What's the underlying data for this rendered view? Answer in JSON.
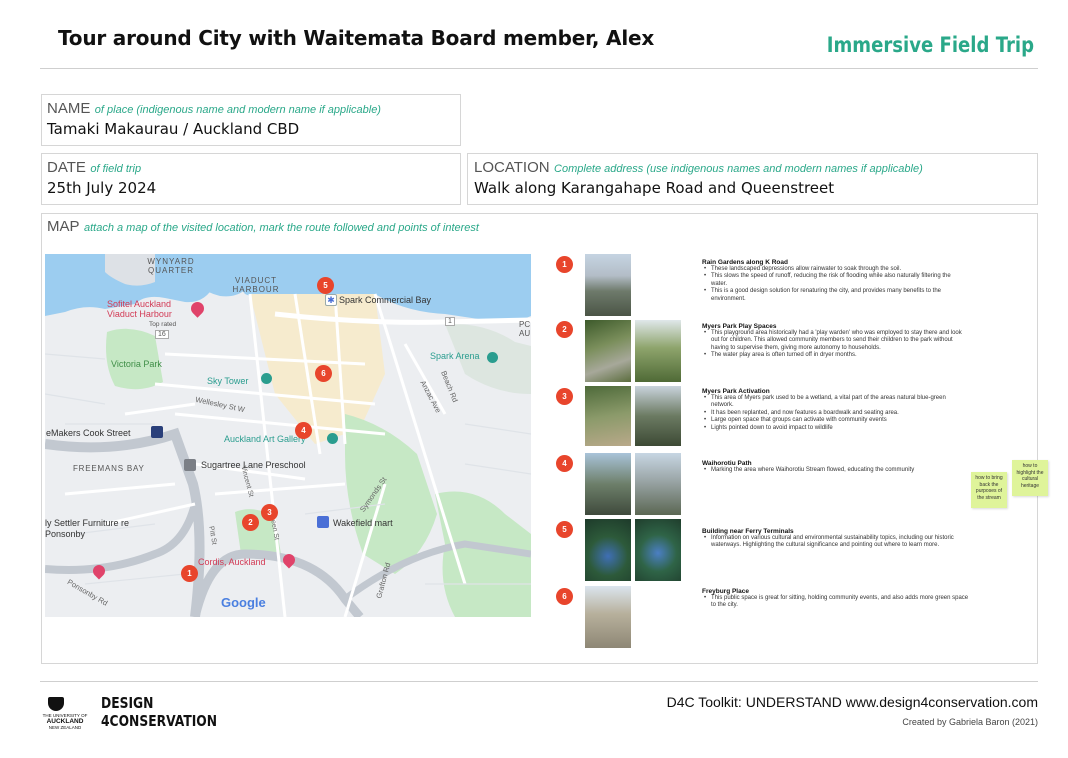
{
  "header": {
    "title": "Tour around City with Waitemata Board member, Alex",
    "brand": "Immersive Field Trip"
  },
  "name_field": {
    "label": "NAME",
    "hint": "of place (indigenous name and modern name if applicable)",
    "value": "Tamaki Makaurau / Auckland CBD"
  },
  "date_field": {
    "label": "DATE",
    "hint": "of field trip",
    "value": "25th July 2024"
  },
  "location_field": {
    "label": "LOCATION",
    "hint": "Complete address (use indigenous names and modern names if applicable)",
    "value": "Walk along Karangahape Road and Queenstreet"
  },
  "map_field": {
    "label": "MAP",
    "hint": "attach a map of the visited location, mark the route followed and points of interest"
  },
  "map": {
    "labels": {
      "wynyard": "WYNYARD QUARTER",
      "viaduct": "VIADUCT HARBOUR",
      "sofitel": "Sofitel Auckland Viaduct Harbour",
      "top_rated": "Top rated",
      "spark_bay": "Spark Commercial Bay",
      "spark_arena": "Spark Arena",
      "victoria_park": "Victoria Park",
      "sky_tower": "Sky Tower",
      "wellesley": "Wellesley St W",
      "makers": "eMakers Cook Street",
      "art_gallery": "Auckland Art Gallery",
      "freemans": "FREEMANS BAY",
      "sugartree": "Sugartree Lane Preschool",
      "settler": "ly Settler Furniture re Ponsonby",
      "wakefield": "Wakefield mart",
      "cordis": "Cordis, Auckland",
      "google": "Google",
      "vincent": "Vincent St",
      "pitt": "Pitt St",
      "queen": "Queen St",
      "symonds": "Symonds St",
      "grafton": "Grafton Rd",
      "beach": "Beach Rd",
      "anzac": "Anzac Ave",
      "ponsonby": "Ponsonby Rd",
      "route_16": "16",
      "route_1": "1",
      "pc": "PC AU"
    },
    "pins": [
      "1",
      "2",
      "3",
      "4",
      "5",
      "6"
    ]
  },
  "points": [
    {
      "num": "1",
      "title": "Rain Gardens along K Road",
      "bullets": [
        "These landscaped depressions allow rainwater to soak through the soil.",
        "This slows the speed of runoff, reducing the risk of flooding while also naturally filtering the water.",
        "This is a good design solution for renaturing the city, and provides many benefits to the environment."
      ]
    },
    {
      "num": "2",
      "title": "Myers Park Play Spaces",
      "bullets": [
        "This playground area historically had a 'play warden' who was employed to stay there and look out for children. This allowed community members to send their children to the park without having to supervise them, giving more autonomy to households.",
        "The water play area is often turned off in dryer months."
      ]
    },
    {
      "num": "3",
      "title": "Myers Park Activation",
      "bullets": [
        "This area of Myers park used to be a wetland, a vital part of the areas natural blue-green network.",
        "It has been replanted, and now features a boardwalk and seating area.",
        "Large open space that groups can activate with community events",
        "Lights pointed down to avoid impact to wildlife"
      ]
    },
    {
      "num": "4",
      "title": "Waihorotiu Path",
      "bullets": [
        "Marking the area where Waihorotiu Stream flowed, educating the community"
      ]
    },
    {
      "num": "5",
      "title": "Building near Ferry Terminals",
      "bullets": [
        "Information on various cultural and environmental sustainability topics, including our historic waterways. Highlighting the cultural significance and pointing out where to learn more."
      ]
    },
    {
      "num": "6",
      "title": "Freyburg Place",
      "bullets": [
        "This public space is great for sitting, holding community events, and also adds more green space to the city."
      ]
    }
  ],
  "stickies": [
    "how to bring back the purposes of the stream",
    "how to highlight the cultural heritage"
  ],
  "footer": {
    "uni_line1": "THE UNIVERSITY OF",
    "uni_line2": "AUCKLAND",
    "uni_line3": "NEW ZEALAND",
    "logo_line1": "DESIGN",
    "logo_line2": "4CONSERVATION",
    "toolkit": "D4C Toolkit: UNDERSTAND www.design4conservation.com",
    "credit": "Created by Gabriela Baron (2021)"
  },
  "colors": {
    "accent": "#2aa889",
    "pin": "#e8452c",
    "sticky": "#dff49a"
  }
}
